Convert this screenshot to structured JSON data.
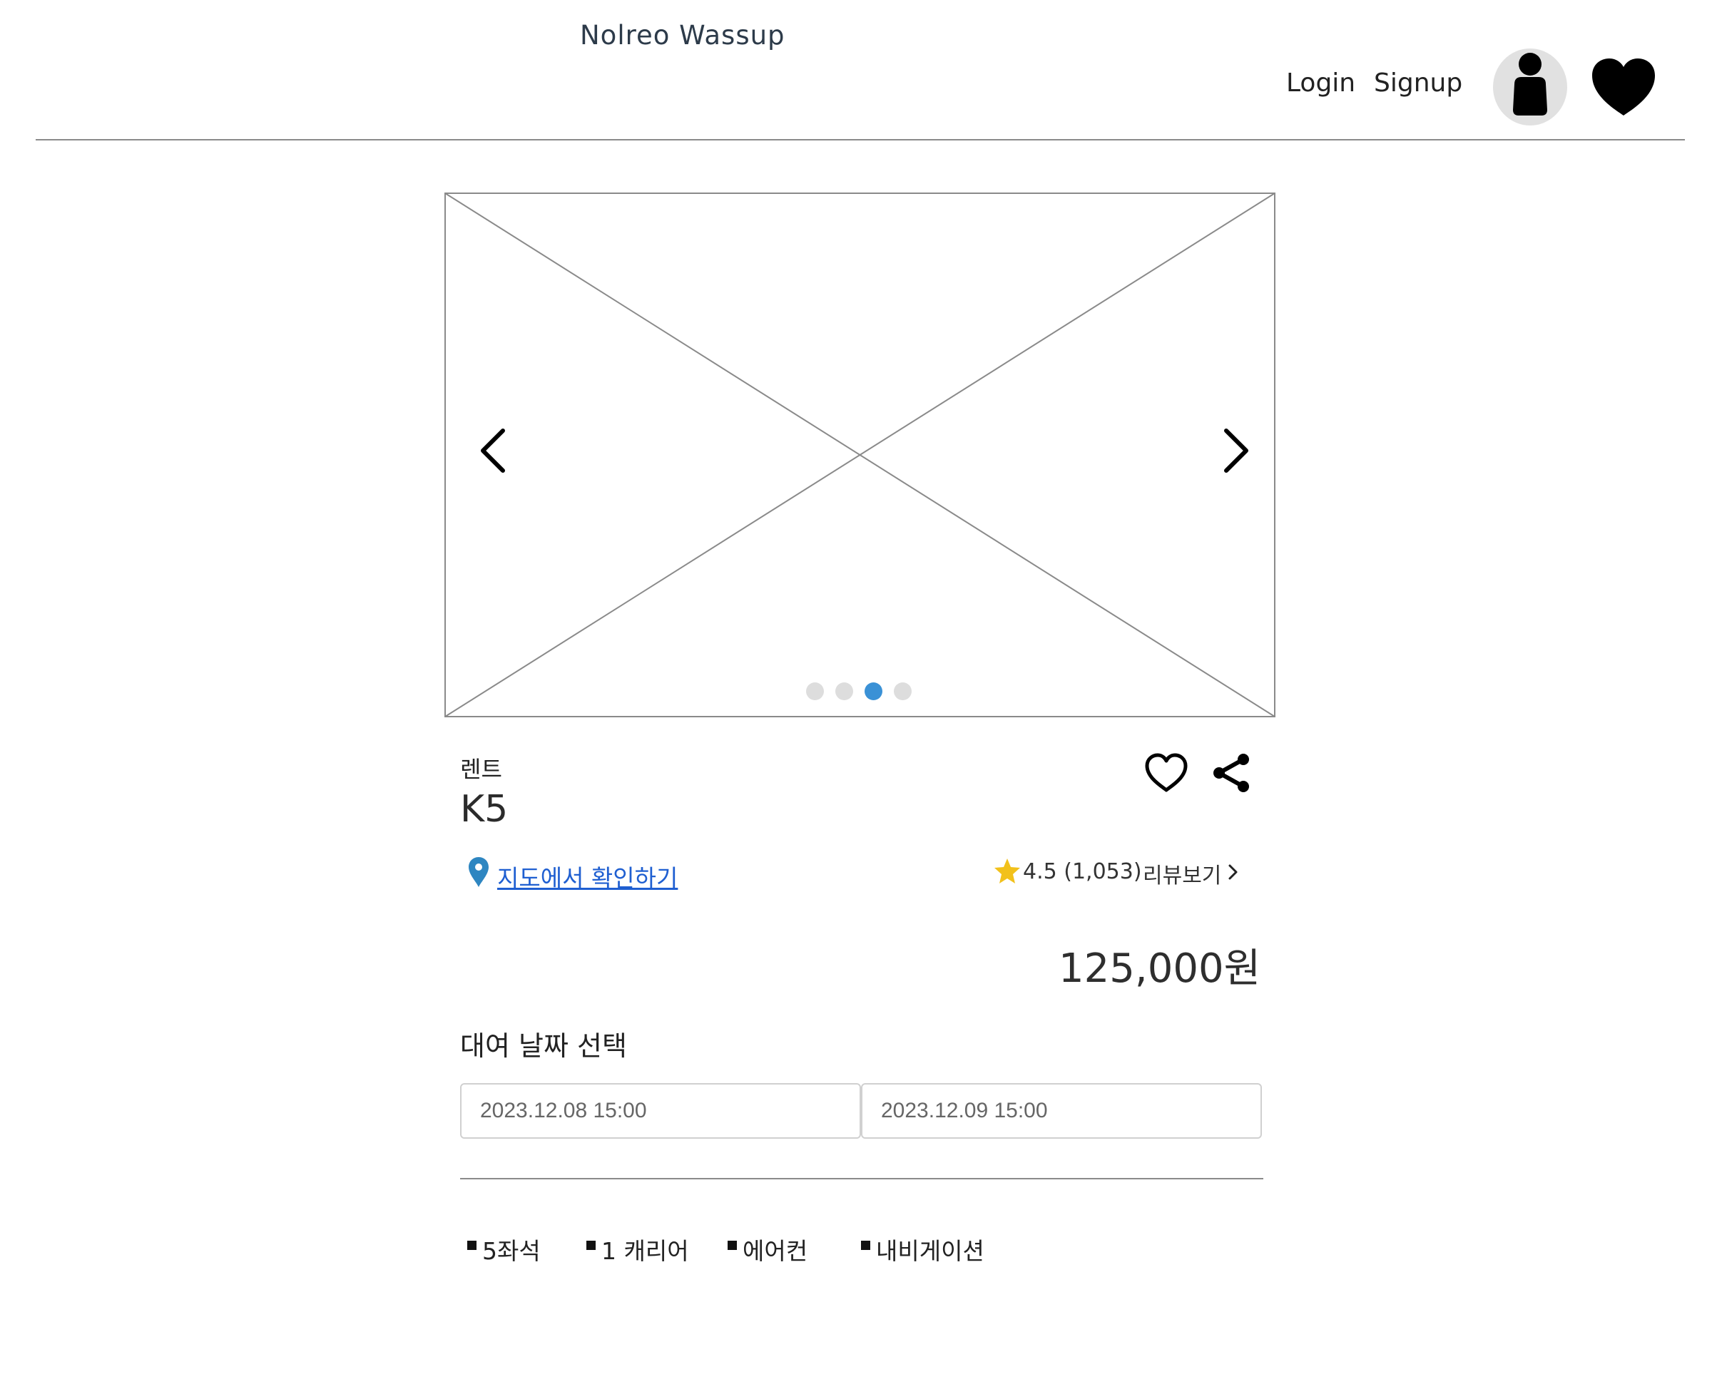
{
  "header": {
    "brand": "Nolreo Wassup",
    "login_label": "Login",
    "signup_label": "Signup",
    "profile_icon": "user-icon",
    "wishlist_icon": "heart-filled-icon"
  },
  "carousel": {
    "image_placeholder": "image-placeholder",
    "prev_icon": "chevron-left-icon",
    "next_icon": "chevron-right-icon",
    "slide_count": 4,
    "active_slide_index": 2,
    "active_dot_color": "#3a91d6",
    "inactive_dot_color": "#dddddd"
  },
  "product": {
    "category": "렌트",
    "name": "K5",
    "map_link": "지도에서 확인하기",
    "rating": "4.5 (1,053)",
    "review_link": "리뷰보기",
    "price": "125,000원",
    "star_color": "#f2c11b",
    "link_color": "#1f5fd1",
    "pin_color": "#2e86c1"
  },
  "rental": {
    "title": "대여 날짜 선택",
    "start": "2023.12.08 15:00",
    "end": "2023.12.09 15:00"
  },
  "features": [
    "5좌석",
    "1 캐리어",
    "에어컨",
    "내비게이션"
  ]
}
